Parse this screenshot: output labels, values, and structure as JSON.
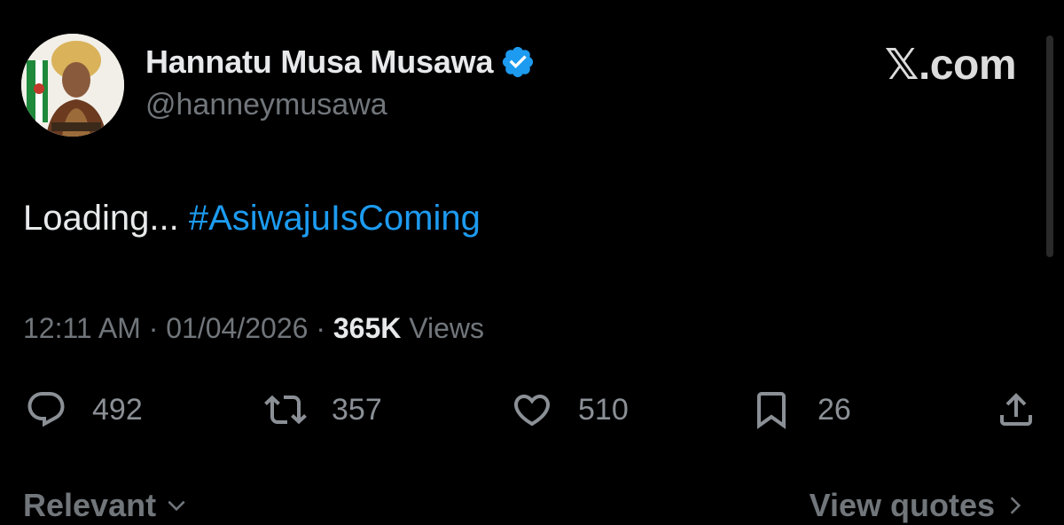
{
  "author": {
    "display_name": "Hannatu Musa Musawa",
    "handle": "@hanneymusawa",
    "verified_icon": "verified-badge-icon",
    "verified_color": "#1d9bf0"
  },
  "brand": {
    "label": "𝕏.com"
  },
  "tweet": {
    "text_plain": "Loading... ",
    "hashtag": "#AsiwajuIsComing",
    "hashtag_color": "#1d9bf0"
  },
  "meta": {
    "time": "12:11 AM",
    "separator": " · ",
    "date": "01/04/2026",
    "views_count": "365K",
    "views_label": " Views"
  },
  "actions": {
    "reply": {
      "icon": "reply-icon",
      "count": "492"
    },
    "retweet": {
      "icon": "retweet-icon",
      "count": "357"
    },
    "like": {
      "icon": "heart-icon",
      "count": "510"
    },
    "bookmark": {
      "icon": "bookmark-icon",
      "count": "26"
    },
    "share": {
      "icon": "share-icon"
    }
  },
  "footer": {
    "sort_label": "Relevant",
    "quotes_label": "View quotes"
  }
}
